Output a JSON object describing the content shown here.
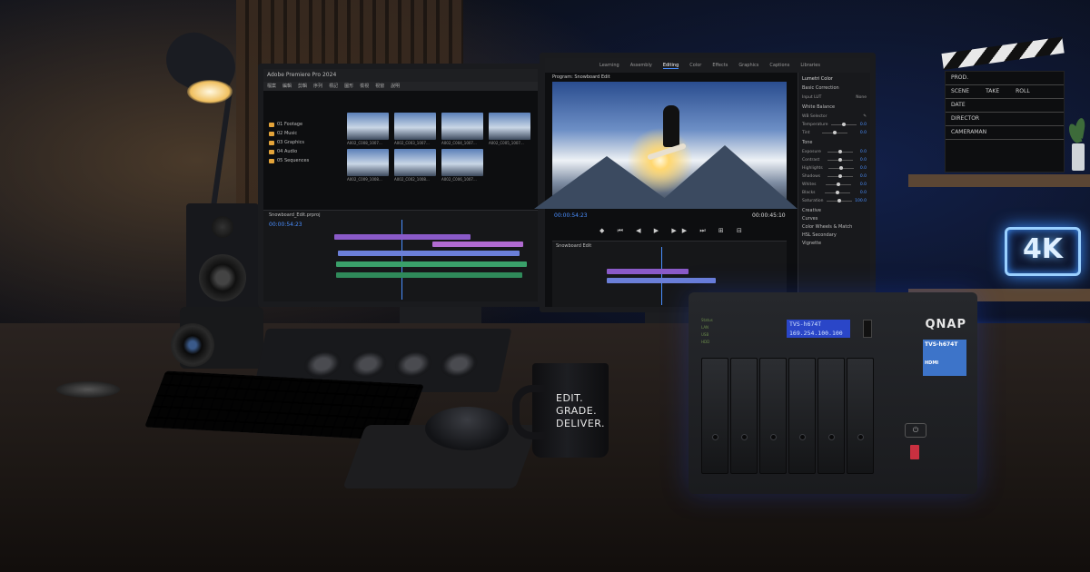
{
  "left_monitor": {
    "app_title": "Adobe Premiere Pro 2024",
    "menu_items": [
      "檔案",
      "編輯",
      "剪輯",
      "序列",
      "標記",
      "圖形",
      "檢視",
      "視窗",
      "說明"
    ],
    "bins": [
      {
        "label": "01 Footage"
      },
      {
        "label": "02 Music"
      },
      {
        "label": "03 Graphics"
      },
      {
        "label": "04 Audio"
      },
      {
        "label": "05 Sequences"
      }
    ],
    "thumbnails": [
      {
        "label": "A002_C008_1007..."
      },
      {
        "label": "A002_C003_1007..."
      },
      {
        "label": "A002_C004_1007..."
      },
      {
        "label": "A002_C005_1007..."
      },
      {
        "label": "A002_C009_1008..."
      },
      {
        "label": "A002_C002_1008..."
      },
      {
        "label": "A002_C006_1007..."
      }
    ],
    "sequence_tab": "Snowboard_Edit.prproj",
    "timecode": "00:00:54:23"
  },
  "right_monitor": {
    "workspace_tabs": [
      "Learning",
      "Assembly",
      "Editing",
      "Color",
      "Effects",
      "Graphics",
      "Captions",
      "Libraries"
    ],
    "active_tab": "Editing",
    "program_label": "Program: Snowboard Edit",
    "timecode_left": "00:00:54:23",
    "timecode_right": "00:00:45:10",
    "sequence_label": "Snowboard Edit",
    "lumetri": {
      "title": "Lumetri Color",
      "basic_correction": "Basic Correction",
      "input_lut": "Input LUT",
      "input_lut_value": "None",
      "white_balance": "White Balance",
      "wb_selector": "WB Selector",
      "tone": "Tone",
      "sliders": [
        {
          "label": "Temperature",
          "value": "0.0"
        },
        {
          "label": "Tint",
          "value": "0.0"
        },
        {
          "label": "Exposure",
          "value": "0.0"
        },
        {
          "label": "Contrast",
          "value": "0.0"
        },
        {
          "label": "Highlights",
          "value": "0.0"
        },
        {
          "label": "Shadows",
          "value": "0.0"
        },
        {
          "label": "Whites",
          "value": "0.0"
        },
        {
          "label": "Blacks",
          "value": "0.0"
        },
        {
          "label": "Saturation",
          "value": "100.0"
        }
      ],
      "sections": [
        "Creative",
        "Curves",
        "Color Wheels & Match",
        "HSL Secondary",
        "Vignette"
      ]
    }
  },
  "mug": {
    "lines": [
      "EDIT.",
      "GRADE.",
      "DELIVER."
    ]
  },
  "nas": {
    "brand": "QNAP",
    "lcd_line1": "TVS-h674T",
    "lcd_line2": "169.254.100.100",
    "sticker_model": "TVS-h674T",
    "sticker_hdmi": "HDMI",
    "led_labels": [
      "Status",
      "LAN",
      "USB",
      "HDD"
    ]
  },
  "clapperboard": {
    "rows": [
      [
        "PROD."
      ],
      [
        "SCENE",
        "TAKE",
        "ROLL"
      ],
      [
        "DATE"
      ],
      [
        "DIRECTOR"
      ],
      [
        "CAMERAMAN"
      ]
    ]
  },
  "neon_sign": "4K",
  "colors": {
    "accent_blue": "#4a8fff",
    "lcd_blue": "#2a46c8",
    "neon": "#9ad0ff"
  }
}
